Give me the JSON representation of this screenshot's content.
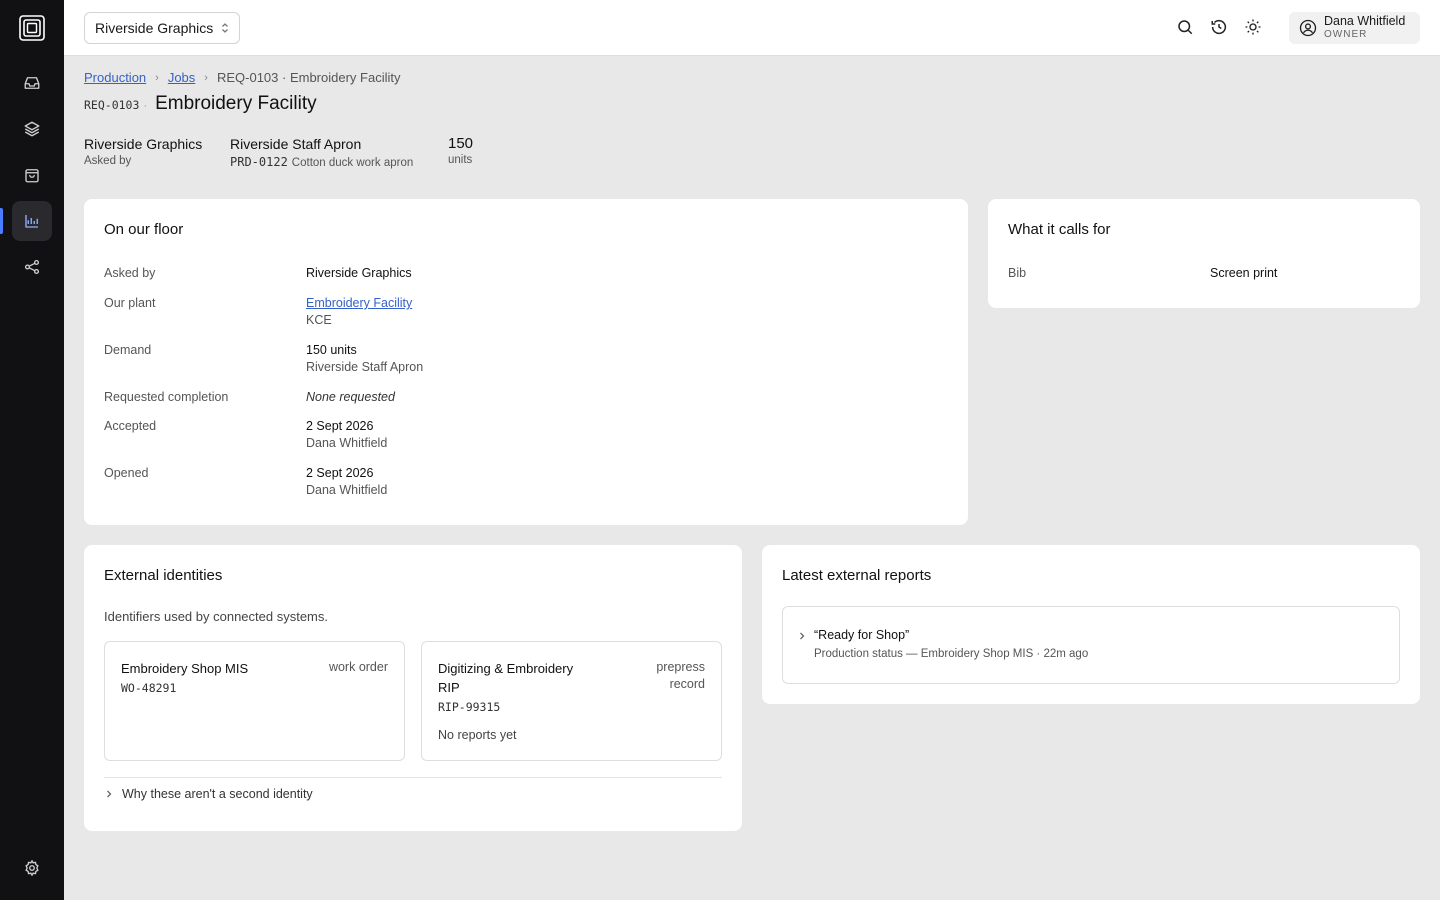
{
  "sidebar": {
    "items": [
      {
        "icon": "inbox-icon"
      },
      {
        "icon": "layers-icon"
      },
      {
        "icon": "shopping-bag-icon"
      },
      {
        "icon": "chart-icon",
        "active": true
      },
      {
        "icon": "share-icon"
      }
    ],
    "settings_icon": "gear-icon"
  },
  "topbar": {
    "org_name": "Riverside Graphics",
    "user": {
      "name": "Dana Whitfield",
      "role": "OWNER"
    }
  },
  "breadcrumb": {
    "items": [
      "Production",
      "Jobs"
    ],
    "current": "REQ-0103 · Embroidery Facility"
  },
  "header": {
    "code": "REQ-0103",
    "sep": "·",
    "title": "Embroidery Facility"
  },
  "summary": {
    "customer": {
      "value": "Riverside Graphics",
      "label": "Asked by"
    },
    "product": {
      "value": "Riverside Staff Apron",
      "code": "PRD-0122",
      "desc": "Cotton duck work apron"
    },
    "quantity": {
      "value": "150",
      "label": "units"
    }
  },
  "floor_card": {
    "title": "On our floor",
    "rows": [
      {
        "label": "Asked by",
        "value": "Riverside Graphics"
      },
      {
        "label": "Our plant",
        "link": "Embroidery Facility",
        "sub": "KCE"
      },
      {
        "label": "Demand",
        "value": "150 units",
        "sub": "Riverside Staff Apron"
      },
      {
        "label": "Requested completion",
        "italic": "None requested"
      },
      {
        "label": "Accepted",
        "value": "2 Sept 2026",
        "sub": "Dana Whitfield"
      },
      {
        "label": "Opened",
        "value": "2 Sept 2026",
        "sub": "Dana Whitfield"
      }
    ]
  },
  "calls_card": {
    "title": "What it calls for",
    "rows": [
      {
        "label": "Bib",
        "value": "Screen print"
      }
    ]
  },
  "identities_card": {
    "title": "External identities",
    "description": "Identifiers used by connected systems.",
    "boxes": [
      {
        "name": "Embroidery Shop MIS",
        "type": "work order",
        "id": "WO-48291"
      },
      {
        "name_line1": "Digitizing & Embroidery",
        "name_line2": "RIP",
        "type_line1": "prepress",
        "type_line2": "record",
        "id": "RIP-99315",
        "note": "No reports yet"
      }
    ],
    "disclosure": "Why these aren't a second identity"
  },
  "reports_card": {
    "title": "Latest external reports",
    "report": {
      "title": "“Ready for Shop”",
      "meta": "Production status — Embroidery Shop MIS · 22m ago"
    }
  }
}
